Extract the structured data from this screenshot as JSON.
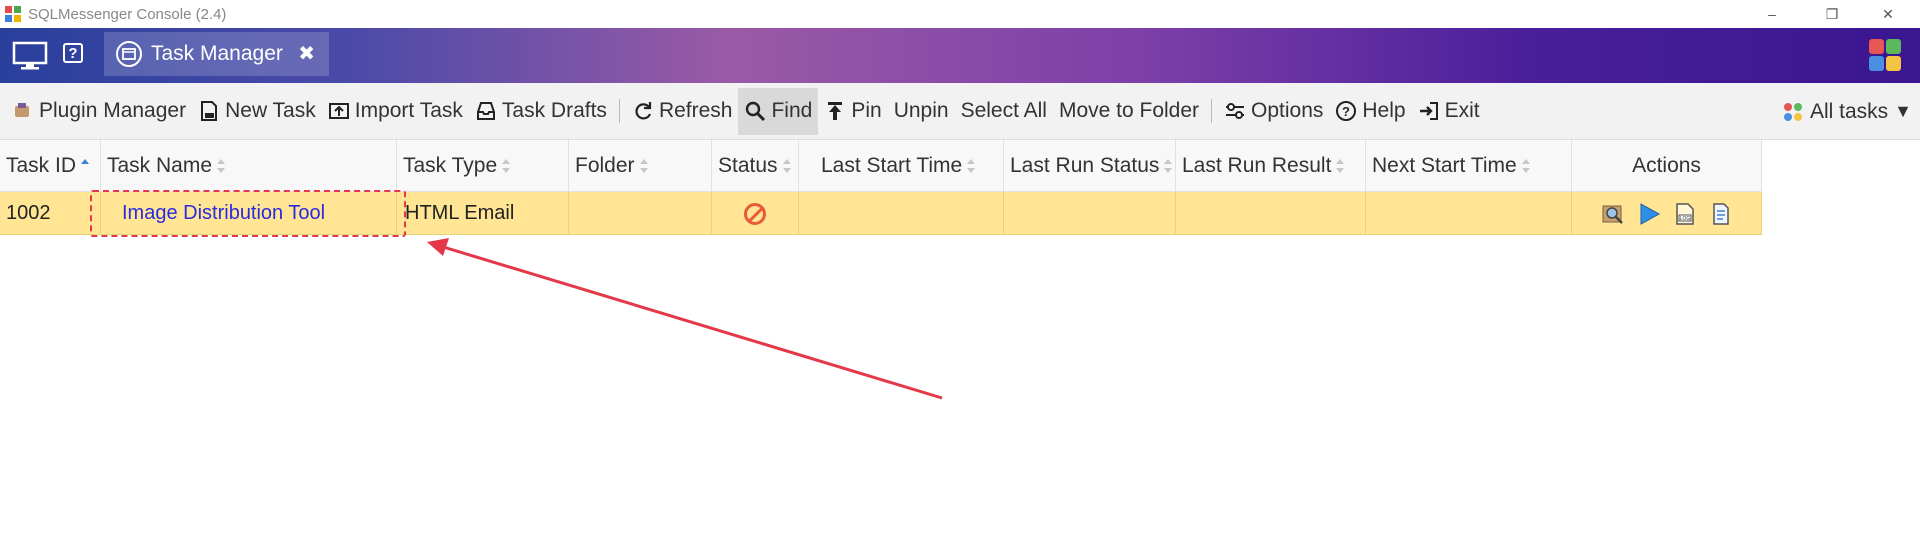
{
  "window": {
    "title": "SQLMessenger Console (2.4)",
    "controls": {
      "minimize": "–",
      "restore": "❐",
      "close": "✕"
    }
  },
  "banner": {
    "tab_label": "Task Manager",
    "tab_close": "✖",
    "help_label": "?"
  },
  "toolbar": {
    "items": [
      {
        "label": "Plugin Manager",
        "icon": "plugin-icon"
      },
      {
        "label": "New Task",
        "icon": "new-task-icon"
      },
      {
        "label": "Import Task",
        "icon": "import-icon"
      },
      {
        "label": "Task Drafts",
        "icon": "drafts-icon"
      },
      {
        "label": "Refresh",
        "icon": "refresh-icon"
      },
      {
        "label": "Find",
        "icon": "search-icon"
      },
      {
        "label": "Pin",
        "icon": "pin-icon"
      },
      {
        "label": "Unpin"
      },
      {
        "label": "Select All"
      },
      {
        "label": "Move to Folder"
      },
      {
        "label": "Options",
        "icon": "options-icon"
      },
      {
        "label": "Help",
        "icon": "help-icon"
      },
      {
        "label": "Exit",
        "icon": "exit-icon"
      }
    ],
    "filter_label": "All tasks",
    "filter_caret": "▼"
  },
  "table": {
    "columns": [
      "Task ID",
      "Task Name",
      "Task Type",
      "Folder",
      "Status",
      "Last Start Time",
      "Last Run Status",
      "Last Run Result",
      "Next Start Time",
      "Actions"
    ],
    "sort": {
      "column": "Task ID",
      "direction": "ascending"
    },
    "rows": [
      {
        "task_id": "1002",
        "task_name": "Image Distribution Tool",
        "task_type": "HTML Email",
        "folder": "",
        "status": "disabled-icon",
        "last_start_time": "",
        "last_run_status": "",
        "last_run_result": "",
        "next_start_time": "",
        "actions": [
          "view-icon",
          "run-icon",
          "log-icon",
          "edit-icon"
        ]
      }
    ]
  },
  "colors": {
    "selected_row": "#ffe594",
    "link": "#2a2ae0",
    "annotation": "#e43848"
  }
}
